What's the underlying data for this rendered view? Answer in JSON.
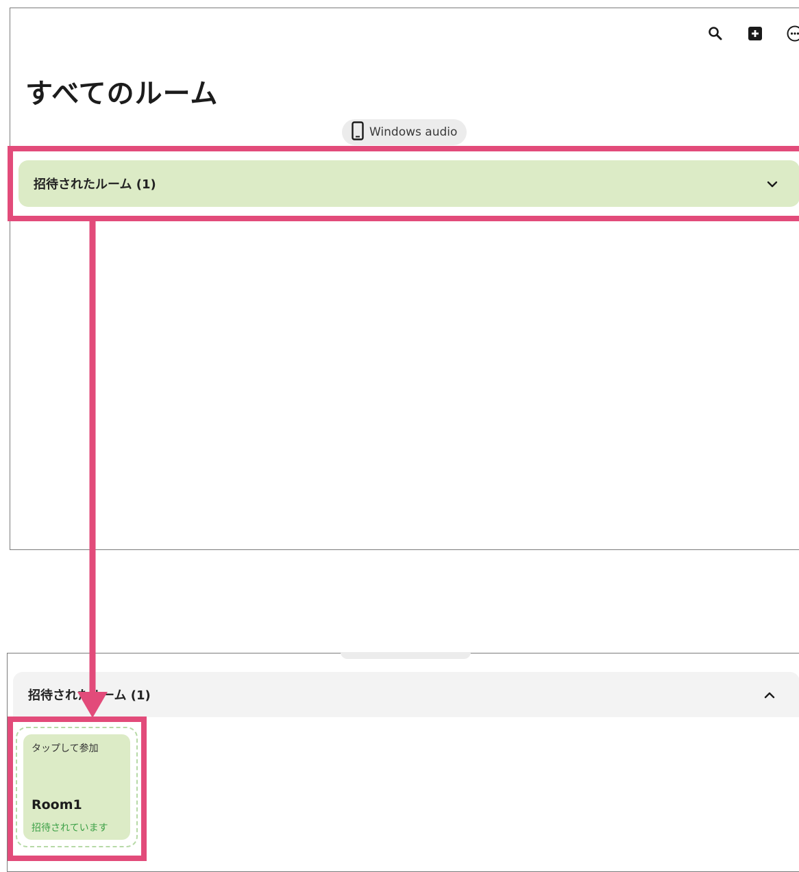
{
  "toolbar": {
    "icons": [
      "search-icon",
      "add-room-icon",
      "more-options-icon"
    ]
  },
  "top_panel": {
    "title": "すべてのルーム",
    "device_chip": {
      "icon": "phone-icon",
      "label": "Windows audio"
    },
    "section": {
      "label": "招待されたルーム (1)",
      "expanded": false,
      "icon": "chevron-down-icon"
    }
  },
  "bottom_panel": {
    "section": {
      "label": "招待されたルーム (1)",
      "expanded": true,
      "icon": "chevron-up-icon"
    },
    "room_card": {
      "action_label": "タップして参加",
      "name": "Room1",
      "status": "招待されています"
    }
  },
  "colors": {
    "highlight": "#e24b7a",
    "section_green": "#dcebc6",
    "invited_status_green": "#3ca046"
  }
}
